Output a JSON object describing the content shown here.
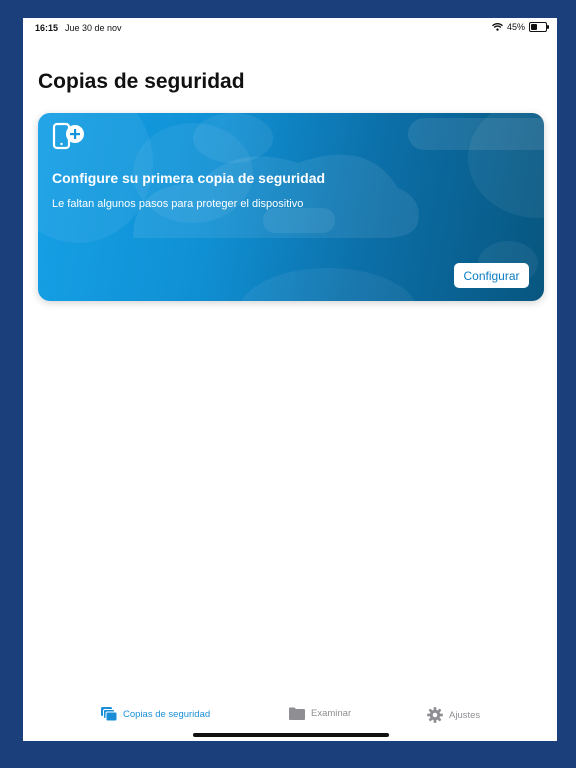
{
  "status_bar": {
    "time": "16:15",
    "date": "Jue 30 de nov",
    "battery_percent": "45%",
    "battery_level": 0.45
  },
  "page": {
    "title": "Copias de seguridad"
  },
  "setup_card": {
    "icon": "phone-add-icon",
    "title": "Configure su primera copia de seguridad",
    "subtitle": "Le faltan algunos pasos para proteger el dispositivo",
    "button_label": "Configurar",
    "gradient_start": "#16a0e6",
    "gradient_end": "#07567f"
  },
  "tab_bar": {
    "active_color": "#1a8fd8",
    "inactive_color": "#8e8e93",
    "tabs": [
      {
        "label": "Copias de seguridad",
        "icon": "copies-icon",
        "active": true
      },
      {
        "label": "Examinar",
        "icon": "folder-icon",
        "active": false
      },
      {
        "label": "Ajustes",
        "icon": "gear-icon",
        "active": false
      }
    ]
  }
}
